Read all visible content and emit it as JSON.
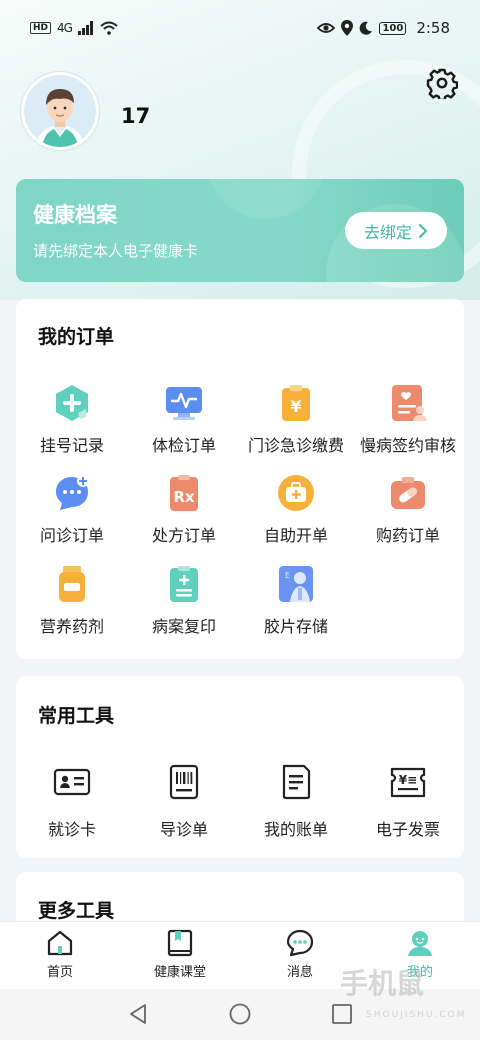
{
  "status": {
    "hd": "HD",
    "network": "4G",
    "battery": "100",
    "time": "2:58"
  },
  "profile": {
    "username": "17"
  },
  "health": {
    "title": "健康档案",
    "subtitle": "请先绑定本人电子健康卡",
    "bind_label": "去绑定"
  },
  "orders": {
    "title": "我的订单",
    "items": [
      {
        "label": "挂号记录",
        "icon": "register-record-icon"
      },
      {
        "label": "体检订单",
        "icon": "checkup-monitor-icon"
      },
      {
        "label": "门诊急诊缴费",
        "icon": "yen-clipboard-icon"
      },
      {
        "label": "慢病签约审核",
        "icon": "chronic-contract-icon"
      },
      {
        "label": "问诊订单",
        "icon": "chat-plus-icon"
      },
      {
        "label": "处方订单",
        "icon": "prescription-rx-icon"
      },
      {
        "label": "自助开单",
        "icon": "medical-kit-icon"
      },
      {
        "label": "购药订单",
        "icon": "pill-box-icon"
      },
      {
        "label": "营养药剂",
        "icon": "nutrition-bottle-icon"
      },
      {
        "label": "病案复印",
        "icon": "record-copy-icon"
      },
      {
        "label": "胶片存储",
        "icon": "film-xray-icon"
      }
    ]
  },
  "tools": {
    "title": "常用工具",
    "items": [
      {
        "label": "就诊卡",
        "icon": "id-card-icon"
      },
      {
        "label": "导诊单",
        "icon": "barcode-slip-icon"
      },
      {
        "label": "我的账单",
        "icon": "bill-document-icon"
      },
      {
        "label": "电子发票",
        "icon": "invoice-receipt-icon"
      }
    ]
  },
  "more": {
    "title": "更多工具"
  },
  "tabs": [
    {
      "label": "首页",
      "icon": "home-icon"
    },
    {
      "label": "健康课堂",
      "icon": "bookmark-book-icon"
    },
    {
      "label": "消息",
      "icon": "message-bubble-icon"
    },
    {
      "label": "我的",
      "icon": "profile-icon"
    }
  ],
  "watermark": {
    "text": "手机鼠",
    "sub": "SHOUJISHU.COM"
  },
  "colors": {
    "accent": "#3fbfa8",
    "card_teal": "#80d6c5"
  }
}
